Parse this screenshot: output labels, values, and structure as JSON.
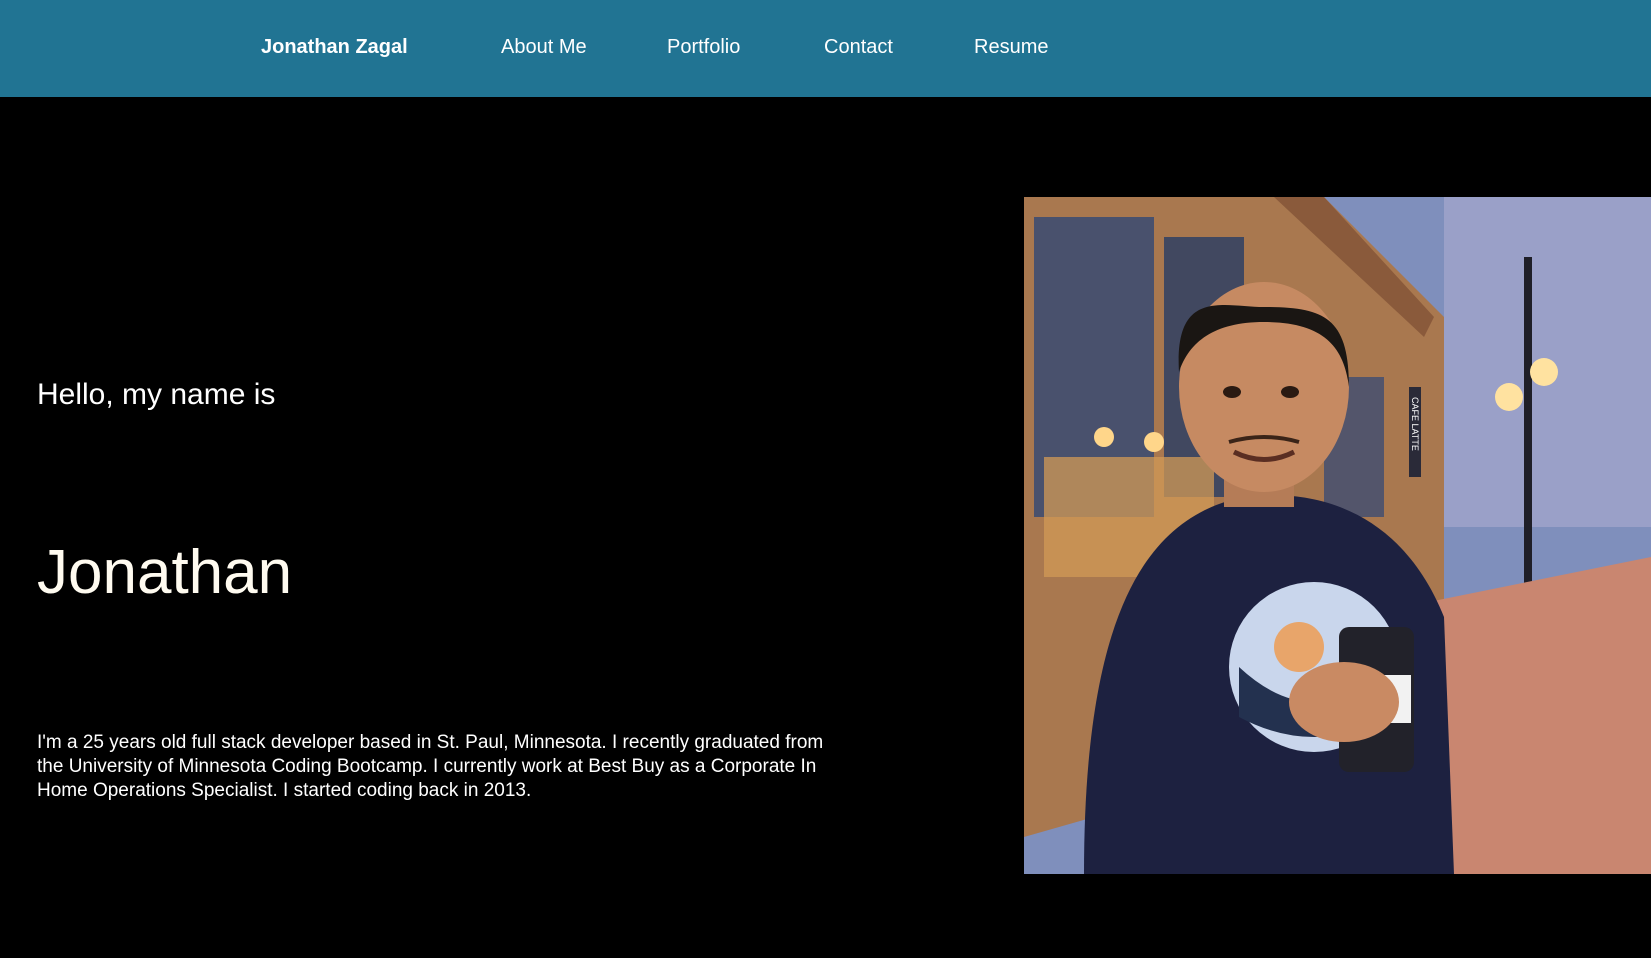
{
  "navbar": {
    "brand": "Jonathan Zagal",
    "links": [
      {
        "label": "About Me"
      },
      {
        "label": "Portfolio"
      },
      {
        "label": "Contact"
      },
      {
        "label": "Resume"
      }
    ],
    "background_color": "#217493"
  },
  "hero": {
    "greeting": "Hello, my name is",
    "name": "Jonathan",
    "bio": "I'm a 25 years old full stack developer based in St. Paul, Minnesota. I recently graduated from the University of Minnesota Coding Bootcamp. I currently work at Best Buy as a Corporate In Home Operations Specialist. I started coding back in 2013.",
    "background_color": "#000000"
  },
  "photo": {
    "subject": "portrait-photo",
    "sign_text": "CAFE LATTE"
  }
}
